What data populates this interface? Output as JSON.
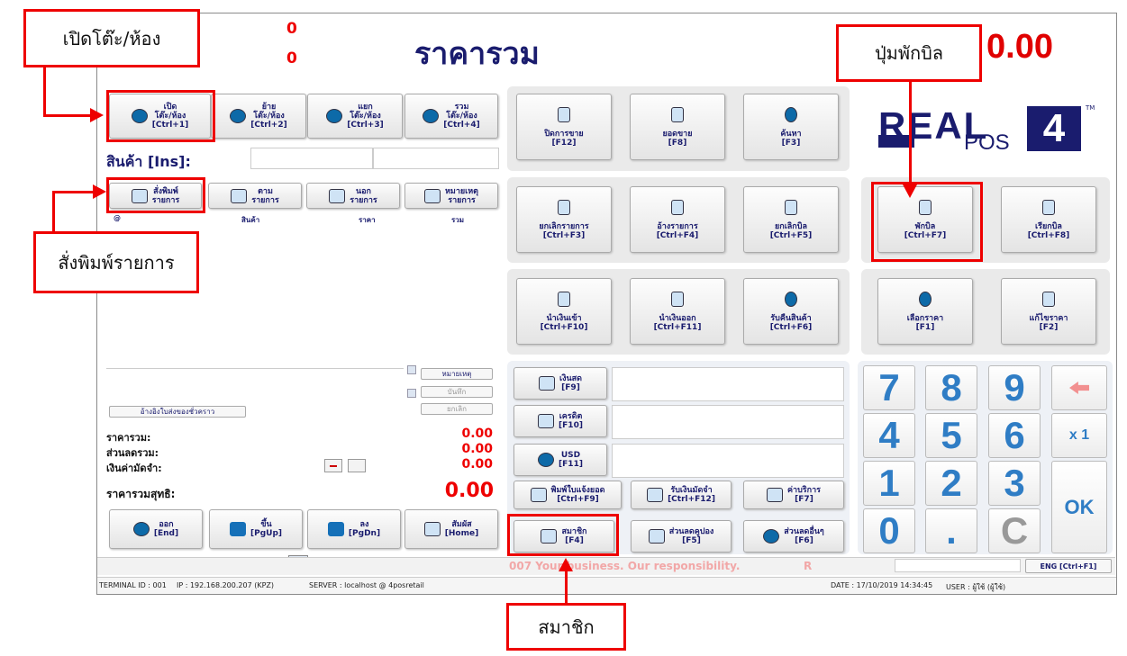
{
  "header": {
    "counter_top": "0",
    "counter_bottom": "0",
    "title": "ราคารวม",
    "total": "0.00"
  },
  "callouts": {
    "open_table": "เปิดโต๊ะ/ห้อง",
    "hold_bill": "ปุ่มพักบิล",
    "print_items": "สั่งพิมพ์รายการ",
    "member": "สมาชิก"
  },
  "table_buttons": [
    {
      "label": "เปิด\nโต๊ะ/ห้อง\n[Ctrl+1]"
    },
    {
      "label": "ย้าย\nโต๊ะ/ห้อง\n[Ctrl+2]"
    },
    {
      "label": "แยก\nโต๊ะ/ห้อง\n[Ctrl+3]"
    },
    {
      "label": "รวม\nโต๊ะ/ห้อง\n[Ctrl+4]"
    }
  ],
  "product": {
    "label": "สินค้า [Ins]:"
  },
  "order_buttons": [
    {
      "label": "สั่งพิมพ์\nรายการ"
    },
    {
      "label": "ตาม\nรายการ"
    },
    {
      "label": "นอก\nรายการ"
    },
    {
      "label": "หมายเหตุ\nรายการ"
    }
  ],
  "columns": [
    "@",
    "สินค้า",
    "ราคา",
    "รวม"
  ],
  "note_buttons": {
    "note": "หมายเหตุ",
    "save": "บันทึก",
    "cancel": "ยกเลิก"
  },
  "ref_button": "อ้างอิงใบส่งของชั่วคราว",
  "summary": {
    "total_label": "ราคารวม:",
    "total": "0.00",
    "discount_label": "ส่วนลดรวม:",
    "discount": "0.00",
    "deposit_label": "เงินค่ามัดจำ:",
    "deposit": "0.00",
    "net_label": "ราคารวมสุทธิ:",
    "net": "0.00"
  },
  "nav_buttons": [
    {
      "label": "ออก\n[End]"
    },
    {
      "label": "ขึ้น\n[PgUp]"
    },
    {
      "label": "ลง\n[PgDn]"
    },
    {
      "label": "สัมผัส\n[Home]"
    }
  ],
  "mid_row1": [
    {
      "label": "ปิดการขาย\n[F12]"
    },
    {
      "label": "ยอดขาย\n[F8]"
    },
    {
      "label": "ค้นหา\n[F3]"
    }
  ],
  "mid_row2": [
    {
      "label": "ยกเลิกรายการ\n[Ctrl+F3]"
    },
    {
      "label": "อ้างรายการ\n[Ctrl+F4]"
    },
    {
      "label": "ยกเลิกบิล\n[Ctrl+F5]"
    }
  ],
  "mid_row3": [
    {
      "label": "นำเงินเข้า\n[Ctrl+F10]"
    },
    {
      "label": "นำเงินออก\n[Ctrl+F11]"
    },
    {
      "label": "รับคืนสินค้า\n[Ctrl+F6]"
    }
  ],
  "logo": {
    "top": "REAL",
    "num": "4",
    "bottom": "POS",
    "tm": "TM"
  },
  "bill_buttons": [
    {
      "label": "พักบิล\n[Ctrl+F7]"
    },
    {
      "label": "เรียกบิล\n[Ctrl+F8]"
    }
  ],
  "price_buttons": [
    {
      "label": "เลือกราคา\n[F1]"
    },
    {
      "label": "แก้ไขราคา\n[F2]"
    }
  ],
  "payments": [
    {
      "label": "เงินสด\n[F9]"
    },
    {
      "label": "เครดิต\n[F10]"
    },
    {
      "label": "USD\n[F11]"
    }
  ],
  "bottom_mid": [
    {
      "label": "พิมพ์ใบแจ้งยอด\n[Ctrl+F9]"
    },
    {
      "label": "รับเงินมัดจำ\n[Ctrl+F12]"
    },
    {
      "label": "ค่าบริการ\n[F7]"
    },
    {
      "label": "สมาชิก\n[F4]"
    },
    {
      "label": "ส่วนลดคูปอง\n[F5]"
    },
    {
      "label": "ส่วนลดอื่นๆ\n[F6]"
    }
  ],
  "keypad": {
    "k7": "7",
    "k8": "8",
    "k9": "9",
    "k4": "4",
    "k5": "5",
    "k6": "6",
    "k1": "1",
    "k2": "2",
    "k3": "3",
    "k0": "0",
    "kdot": ".",
    "kc": "C",
    "x1": "x 1",
    "ok": "OK"
  },
  "ticker": "007 Your business. Our responsibility.",
  "ticker_r": "R",
  "lang_button": "ENG [Ctrl+F1]",
  "status": {
    "terminal": "TERMINAL ID : 001",
    "ip": "IP : 192.168.200.207 (KPZ)",
    "server": "SERVER : localhost @ 4posretail",
    "date": "DATE : 17/10/2019 14:34:45",
    "user": "USER : ผู้ใช้ (ผู้ใช้)"
  },
  "colors": {
    "accent_red": "#e00000",
    "title_navy": "#1a1c6e",
    "keypad_blue": "#2f7dc5"
  }
}
